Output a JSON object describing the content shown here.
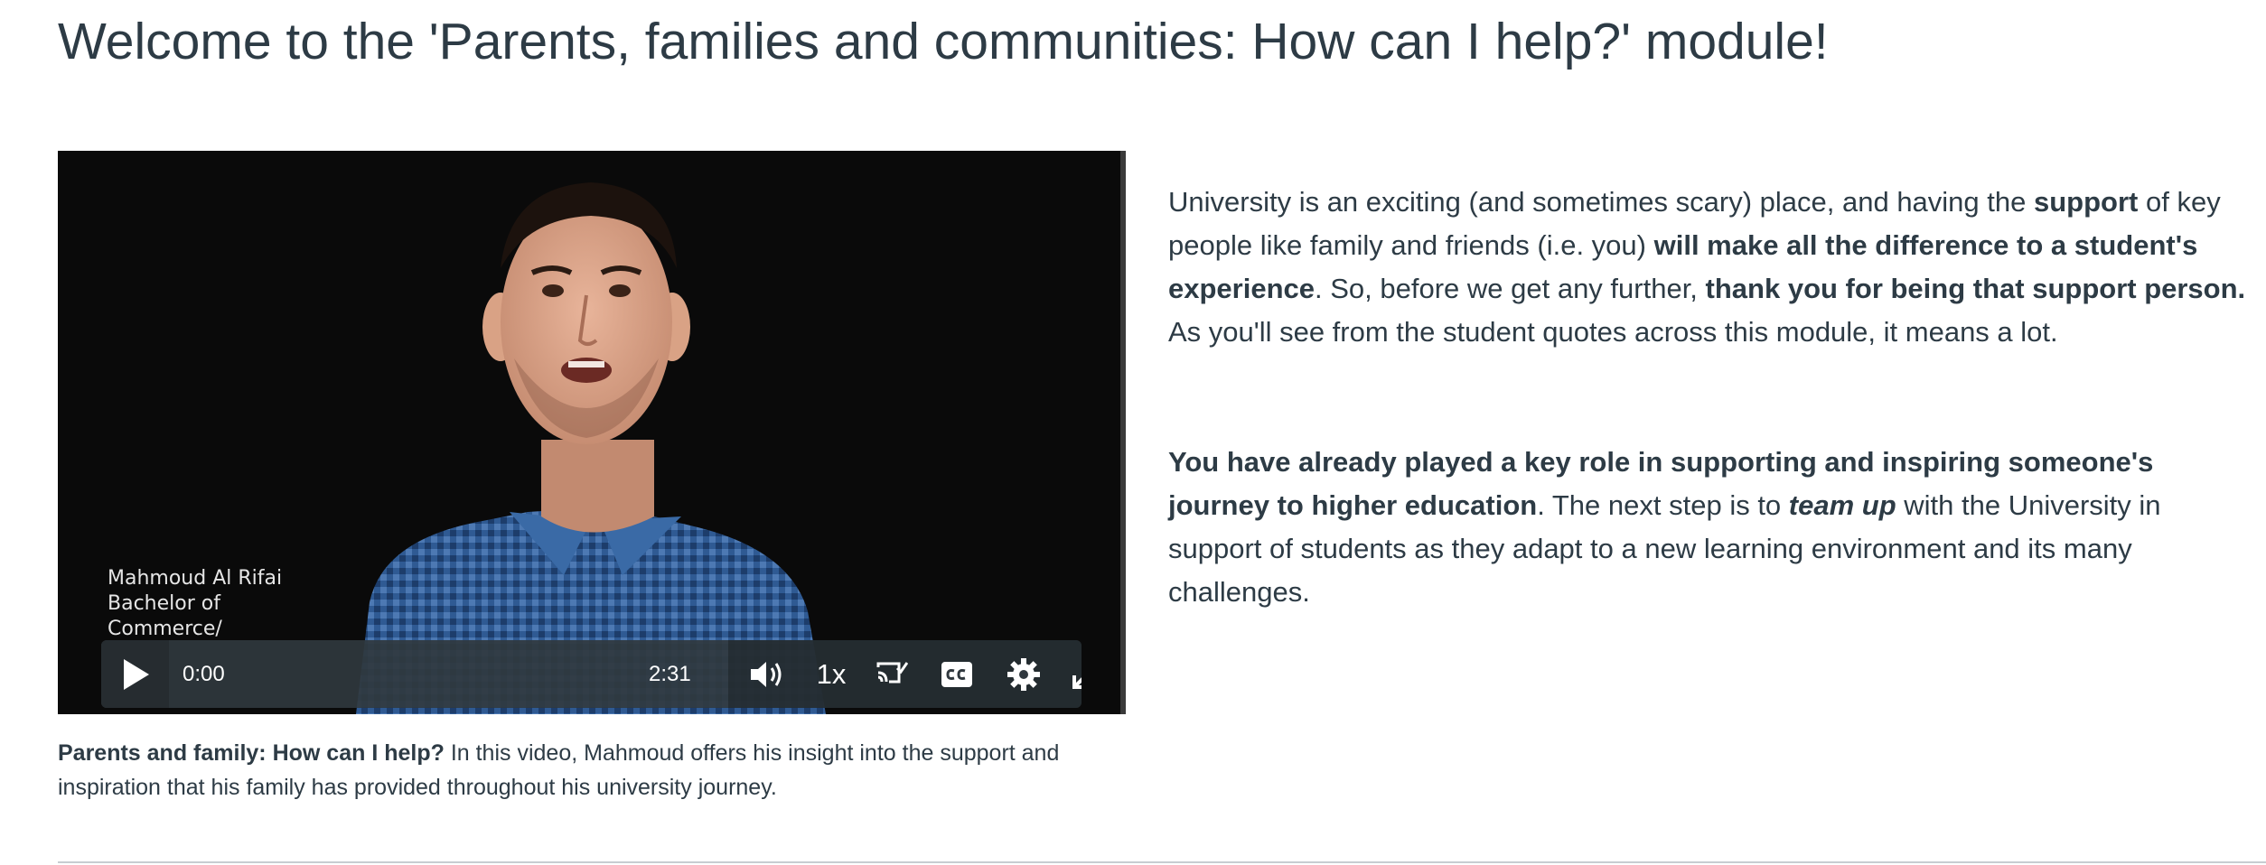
{
  "page": {
    "title": "Welcome to the 'Parents, families and communities: How can I help?' module!"
  },
  "video": {
    "overlay_lines": [
      "Mahmoud Al Rifai",
      "Bachelor of",
      "Commerce/"
    ],
    "current_time": "0:00",
    "duration": "2:31",
    "speed": "1x",
    "progress": 0,
    "icons": [
      "play-icon",
      "volume-icon",
      "cast-icon",
      "closed-captions-icon",
      "gear-icon",
      "fullscreen-icon"
    ]
  },
  "caption": {
    "bold": "Parents and family: How can I help?",
    "text": " In this video, Mahmoud offers his insight into the support and inspiration that his family has provided throughout his university journey."
  },
  "intro": {
    "p1": [
      "University is an exciting (and sometimes scary) place, and having the ",
      "support",
      " of key people like family and friends (i.e. you) ",
      "will make all the difference to a student's experience",
      ". So, before we get any further, ",
      "thank you for being that support person.",
      " As you'll see from the student quotes across this module, it means a lot."
    ],
    "p2": [
      "You have already played a key role in supporting and inspiring someone's journey to higher education",
      ". The next step is to ",
      "team up",
      " with the University in support of students as they adapt to a new learning environment and its many challenges."
    ]
  },
  "colors": {
    "text": "#2d3b45",
    "video_bg": "#0a0a0a",
    "controls_bg": "#30383e",
    "divider": "#c7cdd1"
  }
}
